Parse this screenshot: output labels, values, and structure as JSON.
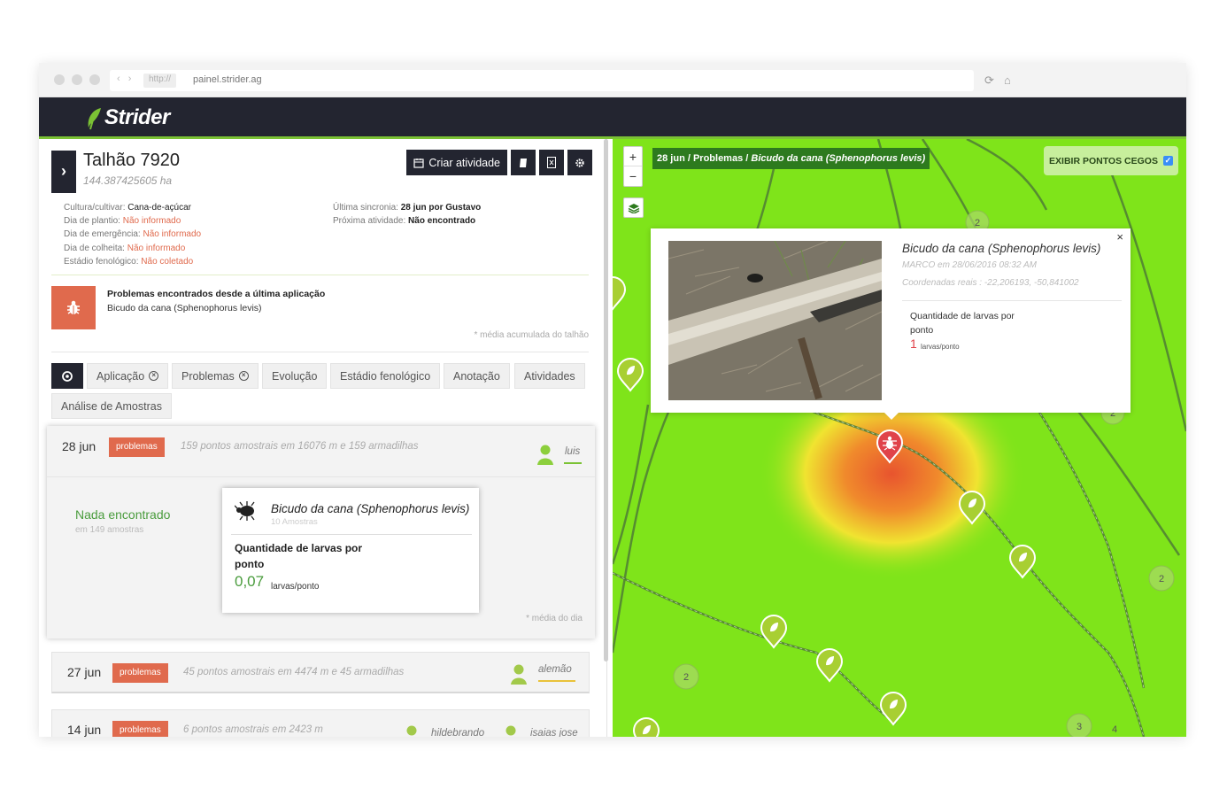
{
  "browser": {
    "nav_arrows": "‹ ›",
    "protocol": "http://",
    "url": "painel.strider.ag"
  },
  "app": {
    "brand": "Strider",
    "accent_color": "#7bc234",
    "danger_color": "#e06a4d"
  },
  "field": {
    "title": "Talhão 7920",
    "area": "144.387425605 ha",
    "info_left": [
      {
        "label": "Cultura/cultivar:",
        "value": "Cana-de-açúcar",
        "style": "strong"
      },
      {
        "label": "Dia de plantio:",
        "value": "Não informado",
        "style": "red"
      },
      {
        "label": "Dia de emergência:",
        "value": "Não informado",
        "style": "red"
      },
      {
        "label": "Dia de colheita:",
        "value": "Não informado",
        "style": "red"
      },
      {
        "label": "Estádio fenológico:",
        "value": "Não coletado",
        "style": "red"
      }
    ],
    "info_right": [
      {
        "label": "Última sincronia:",
        "value": "28 jun por Gustavo"
      },
      {
        "label": "Próxima atividade:",
        "value": "Não encontrado"
      }
    ]
  },
  "toolbar": {
    "create_activity": "Criar atividade",
    "icons": [
      "book-icon",
      "excel-file-icon",
      "gear-icon"
    ]
  },
  "problems": {
    "title": "Problemas encontrados desde a última aplicação",
    "item": "Bicudo da cana (Sphenophorus levis)",
    "note": "* média acumulada do talhão"
  },
  "tabs": [
    {
      "label": "Aplicação",
      "closable": true
    },
    {
      "label": "Problemas",
      "closable": true
    },
    {
      "label": "Evolução",
      "closable": false
    },
    {
      "label": "Estádio fenológico",
      "closable": false
    },
    {
      "label": "Anotação",
      "closable": false
    },
    {
      "label": "Atividades",
      "closable": false
    },
    {
      "label": "Análise de Amostras",
      "closable": false
    }
  ],
  "days": [
    {
      "date": "28 jun",
      "badge": "problemas",
      "desc": "159 pontos amostrais em 16076 m e 159 armadilhas",
      "user": "luis",
      "user_color": "#7bc234",
      "nothing_found": "Nada encontrado",
      "nothing_sub": "em 149 amostras",
      "pest": {
        "name": "Bicudo da cana (Sphenophorus levis)",
        "samples": "10 Amostras",
        "qty_label": "Quantidade de larvas por ponto",
        "value": "0,07",
        "unit": "larvas/ponto"
      },
      "note": "* média do dia"
    },
    {
      "date": "27 jun",
      "badge": "problemas",
      "desc": "45 pontos amostrais em 4474 m e 45 armadilhas",
      "user": "alemão",
      "user_color": "#e9c23a"
    },
    {
      "date": "14 jun",
      "badge": "problemas",
      "desc": "6 pontos amostrais em 2423 m",
      "user": "hildebrando",
      "user2": "isaias jose"
    }
  ],
  "map": {
    "zoom_in": "+",
    "zoom_out": "−",
    "breadcrumb_prefix": "28 jun / Problemas / ",
    "breadcrumb_pest": "Bicudo da cana (Sphenophorus levis)",
    "blind_spots": "EXIBIR PONTOS CEGOS",
    "blind_spots_checked": true,
    "cluster_labels": [
      "2",
      "2",
      "2",
      "2",
      "3",
      "4"
    ],
    "popup": {
      "close": "×",
      "title": "Bicudo da cana (Sphenophorus levis)",
      "meta_user": "MARCO",
      "meta_time": "em 28/06/2016 08:32 AM",
      "coords": "Coordenadas reais : -22,206193, -50,841002",
      "qty_label": "Quantidade de larvas por ponto",
      "value": "1",
      "unit": "larvas/ponto"
    }
  }
}
